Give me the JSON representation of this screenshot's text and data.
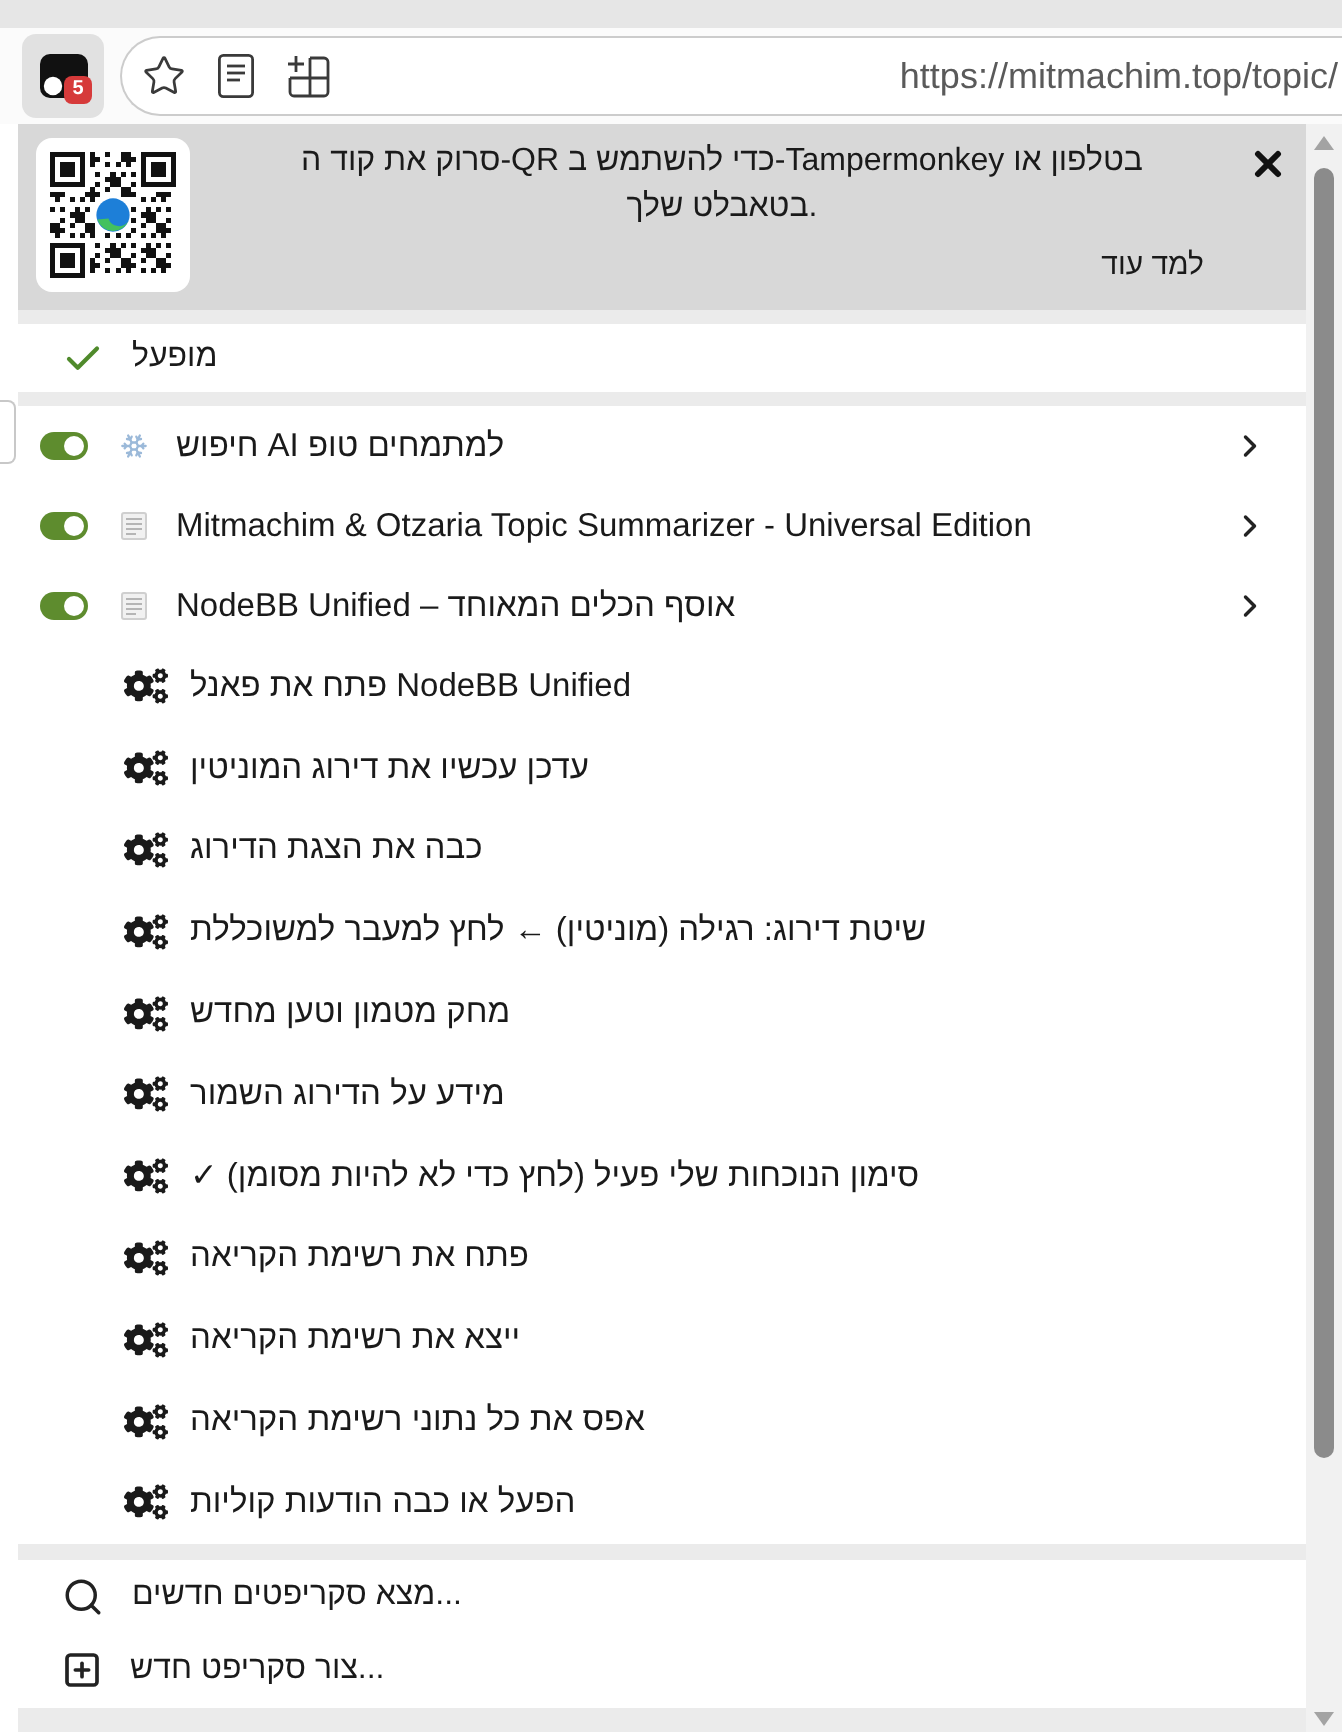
{
  "toolbar": {
    "extension_badge": "5",
    "url": "https://mitmachim.top/topic/"
  },
  "qr_banner": {
    "message": "סרוק את קוד ה-QR כדי להשתמש ב-Tampermonkey בטלפון או בטאבלט שלך.",
    "link": "למד עוד"
  },
  "enabled": {
    "label": "מופעל",
    "checked": true
  },
  "scripts": [
    {
      "name": "חיפוש AI למתמחים טופ",
      "kind": "favicon",
      "on": true
    },
    {
      "name": "Mitmachim & Otzaria Topic Summarizer - Universal Edition",
      "kind": "plain",
      "on": true
    },
    {
      "name": "NodeBB Unified – אוסף הכלים המאוחד",
      "kind": "plain",
      "on": true
    }
  ],
  "commands": [
    "פתח את פאנל NodeBB Unified",
    "עדכן עכשיו את דירוג המוניטין",
    "כבה את הצגת הדירוג",
    "שיטת דירוג: רגילה (מוניטין) ← לחץ למעבר למשוכללת",
    "מחק מטמון וטען מחדש",
    "מידע על הדירוג השמור",
    "✓ סימון הנוכחות שלי פעיל (לחץ כדי לא להיות מסומן)",
    "פתח את רשימת הקריאה",
    "ייצא את רשימת הקריאה",
    "אפס את כל נתוני רשימת הקריאה",
    "הפעל או כבה הודעות קוליות"
  ],
  "actions": [
    {
      "kind": "search",
      "label": "מצא סקריפטים חדשים..."
    },
    {
      "kind": "create",
      "label": "צור סקריפט חדש..."
    }
  ]
}
